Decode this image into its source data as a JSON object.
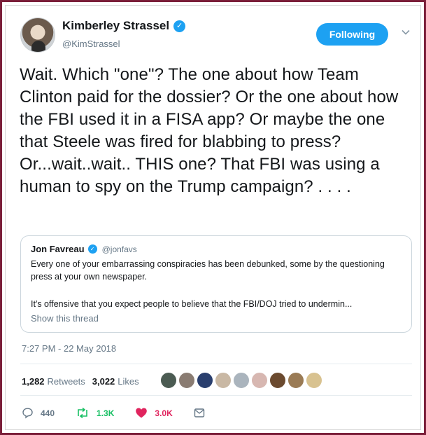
{
  "author": {
    "display_name": "Kimberley Strassel",
    "handle": "@KimStrassel"
  },
  "follow_button": {
    "label": "Following",
    "color": "#1da1f2"
  },
  "tweet": {
    "text": "Wait. Which \"one\"? The one about how Team Clinton paid for the dossier? Or the one about how the FBI used it in a FISA app? Or maybe the one that Steele was fired for blabbing to press? Or...wait..wait.. THIS one? That FBI was using a human to spy on the Trump campaign? . . . ."
  },
  "quoted_tweet": {
    "display_name": "Jon Favreau",
    "handle": "@jonfavs",
    "paragraph_1": "Every one of your embarrassing conspiracies has been debunked, some by the questioning press at your own newspaper.",
    "paragraph_2": "It's offensive that you expect people to believe that the FBI/DOJ tried to undermin...",
    "show_thread": "Show this thread"
  },
  "timestamp": "7:27 PM - 22 May 2018",
  "stats": {
    "retweets_count": "1,282",
    "retweets_label": "Retweets",
    "likes_count": "3,022",
    "likes_label": "Likes"
  },
  "liker_avatars": [
    {
      "name": "liker-avatar-1",
      "color": "#4b5b52"
    },
    {
      "name": "liker-avatar-2",
      "color": "#8a7c72"
    },
    {
      "name": "liker-avatar-3",
      "color": "#2a3f6e"
    },
    {
      "name": "liker-avatar-4",
      "color": "#c9b8a4"
    },
    {
      "name": "liker-avatar-5",
      "color": "#aab4bd"
    },
    {
      "name": "liker-avatar-6",
      "color": "#d7b7b1"
    },
    {
      "name": "liker-avatar-7",
      "color": "#6b4a2f"
    },
    {
      "name": "liker-avatar-8",
      "color": "#9a7b55"
    },
    {
      "name": "liker-avatar-9",
      "color": "#d8c290"
    }
  ],
  "actions": {
    "replies": "440",
    "retweets": "1.3K",
    "likes": "3.0K"
  }
}
